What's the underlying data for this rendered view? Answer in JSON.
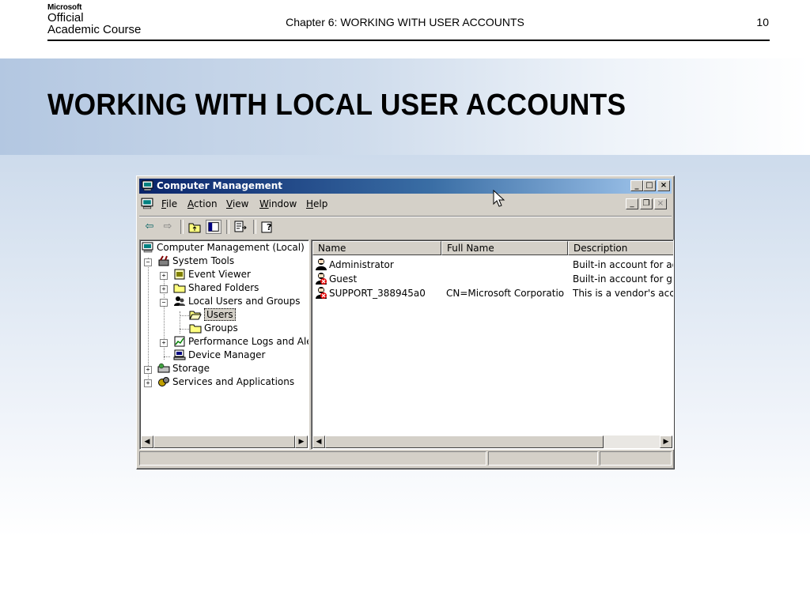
{
  "header": {
    "logo_line1": "Microsoft",
    "logo_line2": "Official",
    "logo_line3": "Academic Course",
    "chapter_title": "Chapter 6: WORKING WITH USER ACCOUNTS",
    "page_number": "10"
  },
  "slide": {
    "title": "WORKING WITH LOCAL USER ACCOUNTS"
  },
  "window": {
    "title": "Computer Management",
    "caption_buttons": [
      "_",
      "□",
      "×"
    ],
    "menu": [
      {
        "label": "File",
        "accel": "F"
      },
      {
        "label": "Action",
        "accel": "A"
      },
      {
        "label": "View",
        "accel": "V"
      },
      {
        "label": "Window",
        "accel": "W"
      },
      {
        "label": "Help",
        "accel": "H"
      }
    ],
    "tree": [
      {
        "label": "Computer Management (Local)",
        "icon": "computer-icon"
      },
      {
        "label": "System Tools",
        "icon": "tools-icon"
      },
      {
        "label": "Event Viewer",
        "icon": "event-viewer-icon"
      },
      {
        "label": "Shared Folders",
        "icon": "folder-icon"
      },
      {
        "label": "Local Users and Groups",
        "icon": "users-icon"
      },
      {
        "label": "Users",
        "icon": "folder-open-icon",
        "selected": true
      },
      {
        "label": "Groups",
        "icon": "folder-icon"
      },
      {
        "label": "Performance Logs and Alerts",
        "icon": "performance-icon"
      },
      {
        "label": "Device Manager",
        "icon": "device-manager-icon"
      },
      {
        "label": "Storage",
        "icon": "storage-icon"
      },
      {
        "label": "Services and Applications",
        "icon": "services-icon"
      }
    ],
    "list": {
      "columns": [
        "Name",
        "Full Name",
        "Description"
      ],
      "rows": [
        {
          "name": "Administrator",
          "full_name": "",
          "description": "Built-in account for admi",
          "disabled": false
        },
        {
          "name": "Guest",
          "full_name": "",
          "description": "Built-in account for gues",
          "disabled": true
        },
        {
          "name": "SUPPORT_388945a0",
          "full_name": "CN=Microsoft Corporation,...",
          "description": "This is a vendor's accou",
          "disabled": true
        }
      ]
    }
  }
}
